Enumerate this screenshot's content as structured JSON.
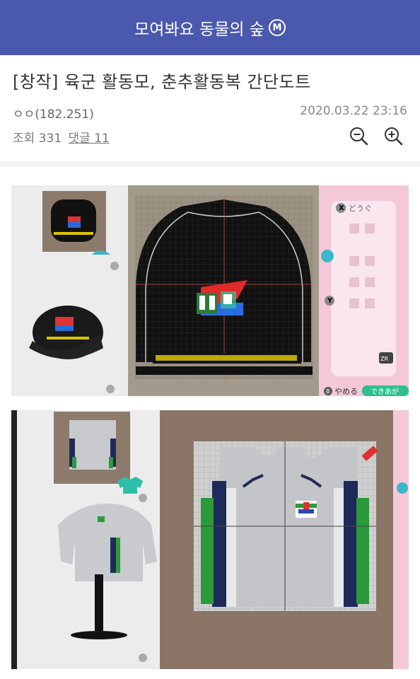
{
  "header": {
    "title": "모여봐요 동물의 숲",
    "badge": "M"
  },
  "post": {
    "title": "[창작] 육군 활동모, 춘추활동복 간단도트",
    "author": "ㅇㅇ(182.251)",
    "datetime": "2020.03.22 23:16",
    "views_label": "조회 331",
    "comments_label": "댓글 11"
  },
  "zoom": {
    "out_icon": "zoom-out-icon",
    "in_icon": "zoom-in-icon"
  },
  "images": {
    "hat_screen": {
      "tool_label": "どうぐ",
      "cancel_label": "やめる",
      "done_label": "できあが",
      "b_key": "B",
      "x_key": "X",
      "y_key": "Y",
      "zr_key": "ZR"
    },
    "shirt_screen": {}
  },
  "colors": {
    "brand": "#4a58ad"
  }
}
